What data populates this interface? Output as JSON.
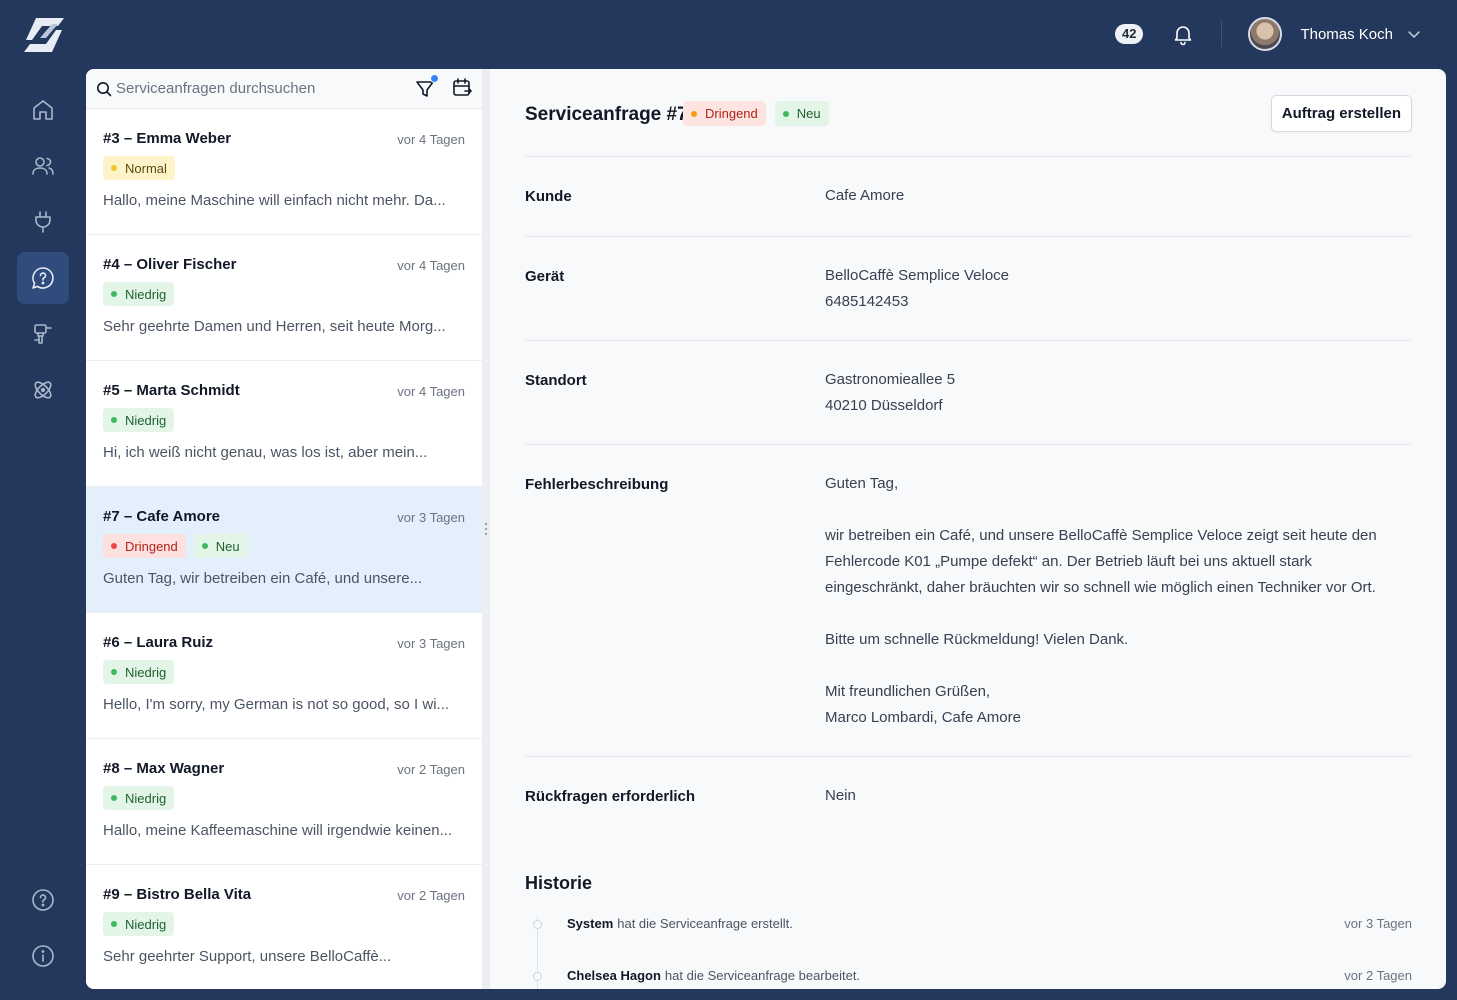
{
  "topbar": {
    "notification_count": "42",
    "user_name": "Thomas Koch"
  },
  "nav": {
    "items": [
      "home-icon",
      "users-icon",
      "plug-icon",
      "support-chat-icon",
      "tools-icon",
      "atom-icon"
    ],
    "bottom": [
      "help-icon",
      "info-icon"
    ],
    "active_color": "#2f4c7d"
  },
  "list": {
    "search_placeholder": "Serviceanfragen durchsuchen",
    "items": [
      {
        "title": "#3 – Emma Weber",
        "time": "vor 4 Tagen",
        "tags": [
          {
            "label": "Normal",
            "kind": "normal"
          }
        ],
        "preview": "Hallo, meine Maschine will einfach nicht mehr. Da..."
      },
      {
        "title": "#4 – Oliver Fischer",
        "time": "vor 4 Tagen",
        "tags": [
          {
            "label": "Niedrig",
            "kind": "green"
          }
        ],
        "preview": "Sehr geehrte Damen und Herren, seit heute Morg..."
      },
      {
        "title": "#5 – Marta Schmidt",
        "time": "vor 4 Tagen",
        "tags": [
          {
            "label": "Niedrig",
            "kind": "green"
          }
        ],
        "preview": "Hi, ich weiß nicht genau, was los ist, aber mein..."
      },
      {
        "title": "#7 – Cafe Amore",
        "time": "vor 3 Tagen",
        "tags": [
          {
            "label": "Dringend",
            "kind": "red"
          },
          {
            "label": "Neu",
            "kind": "green"
          }
        ],
        "preview": "Guten Tag, wir betreiben ein Café, und unsere..."
      },
      {
        "title": "#6 – Laura Ruiz",
        "time": "vor 3 Tagen",
        "tags": [
          {
            "label": "Niedrig",
            "kind": "green"
          }
        ],
        "preview": "Hello, I'm sorry, my German is not so good, so I wi..."
      },
      {
        "title": "#8 – Max Wagner",
        "time": "vor 2 Tagen",
        "tags": [
          {
            "label": "Niedrig",
            "kind": "green"
          }
        ],
        "preview": "Hallo, meine Kaffeemaschine will irgendwie keinen..."
      },
      {
        "title": "#9 – Bistro Bella Vita",
        "time": "vor 2 Tagen",
        "tags": [
          {
            "label": "Niedrig",
            "kind": "green"
          }
        ],
        "preview": "Sehr geehrter Support, unsere BelloCaffè..."
      }
    ]
  },
  "detail": {
    "title": "Serviceanfrage #7",
    "tags": [
      {
        "label": "Dringend",
        "kind": "orange"
      },
      {
        "label": "Neu",
        "kind": "green"
      }
    ],
    "create_button": "Auftrag erstellen",
    "fields": {
      "kunde_label": "Kunde",
      "kunde_value": "Cafe Amore",
      "geraet_label": "Gerät",
      "geraet_value": "BelloCaffè Semplice Veloce\n6485142453",
      "standort_label": "Standort",
      "standort_value": "Gastronomieallee 5\n40210 Düsseldorf",
      "fehler_label": "Fehlerbeschreibung",
      "fehler_paragraphs": [
        "Guten Tag,",
        "wir betreiben ein Café, und unsere BelloCaffè Semplice Veloce zeigt seit heute den Fehlercode K01 „Pumpe defekt“ an. Der Betrieb läuft bei uns aktuell stark eingeschränkt, daher bräuchten wir so schnell wie möglich einen Techniker vor Ort.",
        "Bitte um schnelle Rückmeldung! Vielen Dank.",
        "Mit freundlichen Grüßen,\nMarco Lombardi, Cafe Amore"
      ],
      "rueckfragen_label": "Rückfragen erforderlich",
      "rueckfragen_value": "Nein"
    },
    "history_title": "Historie",
    "history": [
      {
        "actor": "System",
        "text": "hat die Serviceanfrage erstellt.",
        "time": "vor 3 Tagen"
      },
      {
        "actor": "Chelsea Hagon",
        "text": "hat die Serviceanfrage bearbeitet.",
        "time": "vor 2 Tagen"
      }
    ]
  }
}
